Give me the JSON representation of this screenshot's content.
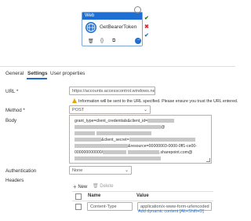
{
  "activity": {
    "type_label": "Web",
    "name": "GetBearerToken",
    "tool_delete_glyph": "🗑",
    "tool_params_glyph": "{}",
    "tool_copy_glyph": "⧉",
    "tool_arrow_glyph": "→",
    "status_icons": [
      "skip-icon",
      "success-icon",
      "failure-icon",
      "completion-icon"
    ],
    "status_colors": {
      "skip": "#8a8886",
      "success": "#107c10",
      "failure": "#d13438",
      "completion": "#1f6fd2"
    }
  },
  "tabs": [
    {
      "label": "General",
      "active": false
    },
    {
      "label": "Settings",
      "active": true
    },
    {
      "label": "User properties",
      "active": false
    }
  ],
  "form": {
    "url": {
      "label": "URL *",
      "value": "https://accounts.accesscontrol.windows.net"
    },
    "url_warning": "Information will be sent to the URL specified. Please ensure you trust the URL entered.",
    "method": {
      "label": "Method *",
      "value": "POST"
    },
    "body": {
      "label": "Body",
      "lines": [
        "grant_type=client_credentials&client_id=",
        "@",
        "&client_secret=",
        "&resource=00000003-0000-0ff1-ce00-",
        "000000000000/",
        ".sharepoint.com@"
      ]
    },
    "authentication": {
      "label": "Authentication",
      "value": "None"
    },
    "headers": {
      "label": "Headers",
      "new_label": "New",
      "delete_label": "Delete",
      "columns": [
        "Name",
        "Value"
      ],
      "rows": [
        {
          "name": "Content-Type",
          "value": "application/x-www-form-urlencoded"
        }
      ],
      "dynamic_link": "Add dynamic content [Alt+Shift+D]"
    }
  },
  "theme": {
    "accent": "#1f6fd2",
    "warning": "#e8a400"
  }
}
